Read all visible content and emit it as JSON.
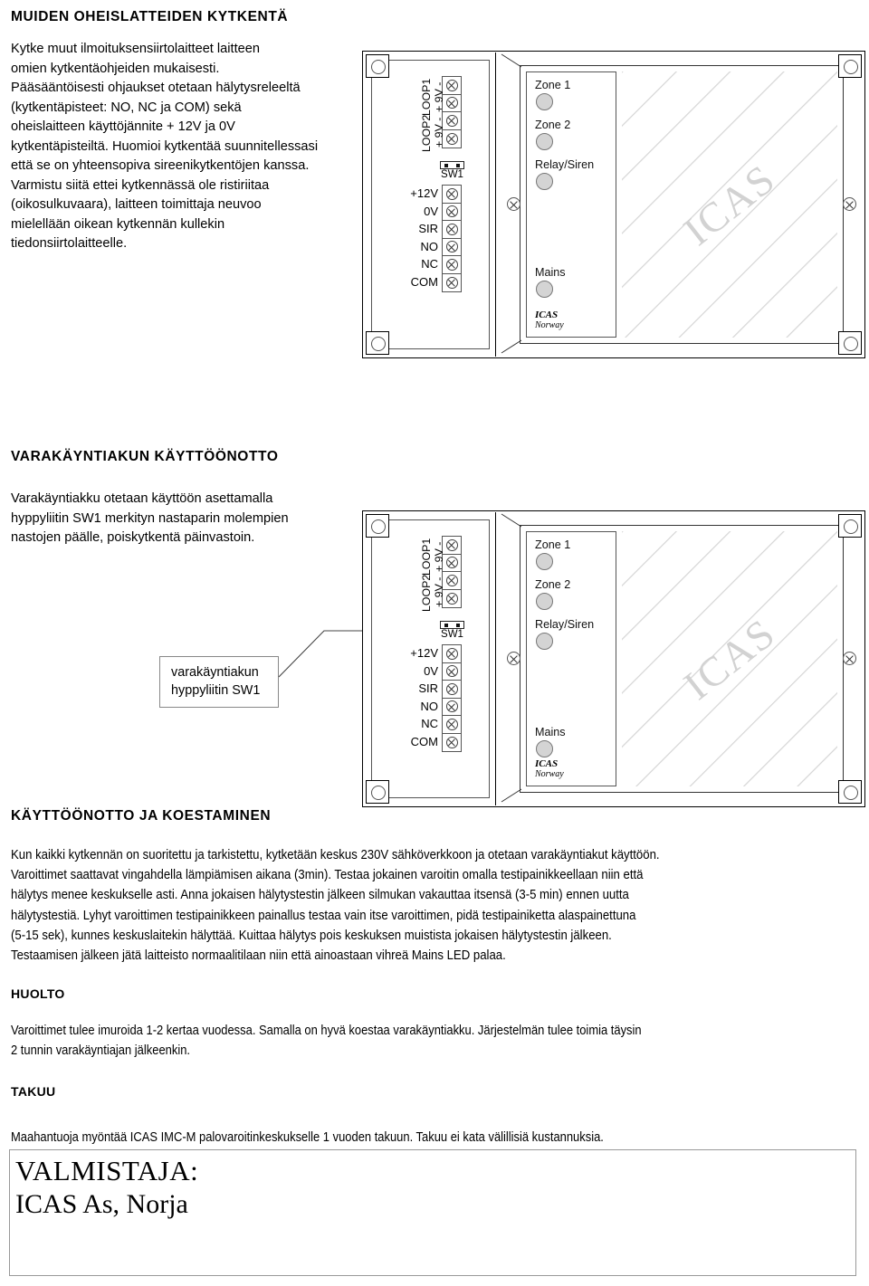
{
  "sections": {
    "peripherals": {
      "heading": "MUIDEN OHEISLATTEIDEN KYTKENTÄ",
      "body_lines": [
        "Kytke muut ilmoituksensiirtolaitteet laitteen",
        "omien kytkentäohjeiden mukaisesti.",
        "Pääsääntöisesti ohjaukset otetaan hälytysreleeltä",
        "(kytkentäpisteet: NO, NC ja COM) sekä",
        "oheislaitteen käyttöjännite + 12V ja 0V",
        "kytkentäpisteiltä. Huomioi kytkentää suunnitellessasi",
        "että se on yhteensopiva sireenikytkentöjen kanssa.",
        "Varmistu siitä ettei kytkennässä ole ristiriitaa",
        "(oikosulkuvaara), laitteen toimittaja neuvoo",
        "mielellään oikean kytkennän kullekin",
        "tiedonsiirtolaitteelle."
      ]
    },
    "battery": {
      "heading": "VARAKÄYNTIAKUN KÄYTTÖÖNOTTO",
      "body_lines": [
        "Varakäyntiakku otetaan käyttöön asettamalla",
        "hyppyliitin SW1 merkityn nastaparin molempien",
        "nastojen päälle, poiskytkentä päinvastoin."
      ],
      "callout_lines": [
        "varakäyntiakun",
        "hyppyliitin SW1"
      ]
    },
    "commissioning": {
      "heading": "KÄYTTÖÖNOTTO JA KOESTAMINEN",
      "body_lines": [
        "Kun kaikki kytkennän on suoritettu ja tarkistettu, kytketään keskus 230V sähköverkkoon ja otetaan varakäyntiakut käyttöön.",
        "Varoittimet saattavat vingahdella lämpiämisen aikana (3min). Testaa jokainen varoitin omalla testipainikkeellaan niin että",
        "hälytys menee keskukselle asti. Anna jokaisen hälytystestin jälkeen silmukan vakauttaa itsensä (3-5 min) ennen uutta",
        "hälytystestiä. Lyhyt varoittimen testipainikkeen painallus testaa vain itse varoittimen, pidä testipainiketta alaspainettuna",
        "(5-15 sek), kunnes keskuslaitekin hälyttää. Kuittaa hälytys pois keskuksen muistista jokaisen hälytystestin jälkeen.",
        "Testaamisen jälkeen jätä laitteisto normaalitilaan niin että ainoastaan vihreä Mains LED palaa."
      ]
    },
    "maintenance": {
      "heading": "HUOLTO",
      "body_lines": [
        "Varoittimet tulee imuroida 1-2 kertaa vuodessa. Samalla on hyvä koestaa varakäyntiakku. Järjestelmän tulee toimia täysin",
        "2 tunnin varakäyntiajan jälkeenkin."
      ]
    },
    "warranty": {
      "heading": "TAKUU",
      "body_lines": [
        "Maahantuoja myöntää ICAS IMC-M palovaroitinkeskukselle 1 vuoden takuun. Takuu ei kata välillisiä kustannuksia."
      ]
    },
    "manufacturer": {
      "line1": "VALMISTAJA:",
      "line2": "ICAS As, Norja"
    }
  },
  "panel": {
    "loop_labels": [
      "LOOP1",
      "+ 9V -",
      "LOOP2",
      "+ 9V -"
    ],
    "loop_stack": [
      "+ 9V -",
      "LOOP1",
      "+ 9V -",
      "LOOP2"
    ],
    "terminal_labels": [
      "+12V",
      "0V",
      "SIR",
      "NO",
      "NC",
      "COM"
    ],
    "jumper": {
      "label": "SW1",
      "pins": 2
    },
    "leds": [
      {
        "label": "Zone 1",
        "color": "#d4d4d4"
      },
      {
        "label": "Zone 2",
        "color": "#d4d4d4"
      },
      {
        "label": "Relay/Siren",
        "color": "#d4d4d4"
      },
      {
        "label": "Mains",
        "color": "#d4d4d4"
      }
    ],
    "brand_line1": "ICAS",
    "brand_line2": "Norway",
    "watermark": "ICAS",
    "loop_top_terminals": 4,
    "bottom_terminals": 6
  },
  "colors": {
    "ink": "#000000",
    "rule": "#555555",
    "led_fill": "#d4d4d4",
    "hatch": "#d5d5d5",
    "watermark": "#d2d2d2"
  }
}
